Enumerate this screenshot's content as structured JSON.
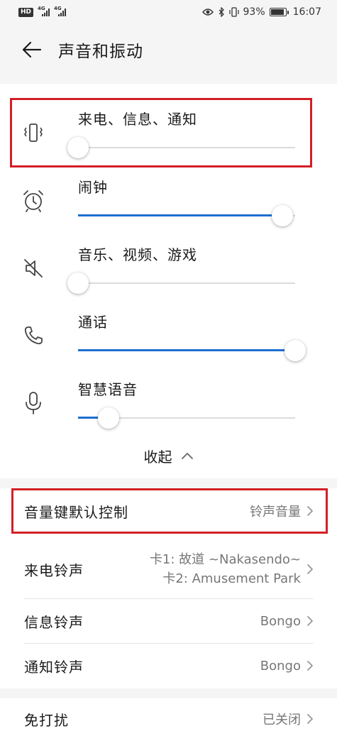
{
  "status_bar": {
    "hd_badge": "HD",
    "signal1_label": "4G",
    "signal2_label": "4G",
    "battery_percent": "93%",
    "battery_level": 0.93,
    "time": "16:07"
  },
  "header": {
    "title": "声音和振动"
  },
  "volumes": [
    {
      "label": "来电、信息、通知",
      "icon": "vibrate-icon",
      "level": 0.0
    },
    {
      "label": "闹钟",
      "icon": "alarm-clock-icon",
      "level": 0.94
    },
    {
      "label": "音乐、视频、游戏",
      "icon": "muted-speaker-icon",
      "level": 0.0
    },
    {
      "label": "通话",
      "icon": "phone-icon",
      "level": 1.0
    },
    {
      "label": "智慧语音",
      "icon": "microphone-icon",
      "level": 0.14
    }
  ],
  "collapse": {
    "label": "收起"
  },
  "volume_key": {
    "title": "音量键默认控制",
    "value": "铃声音量"
  },
  "ringtones": {
    "incoming": {
      "title": "来电铃声",
      "sim1": "卡1: 故道 ~Nakasendo~",
      "sim2": "卡2: Amusement Park"
    },
    "message": {
      "title": "信息铃声",
      "value": "Bongo"
    },
    "notification": {
      "title": "通知铃声",
      "value": "Bongo"
    }
  },
  "dnd": {
    "title": "免打扰",
    "value": "已关闭"
  },
  "colors": {
    "accent": "#1e6fd0",
    "highlight": "#d31f26"
  }
}
